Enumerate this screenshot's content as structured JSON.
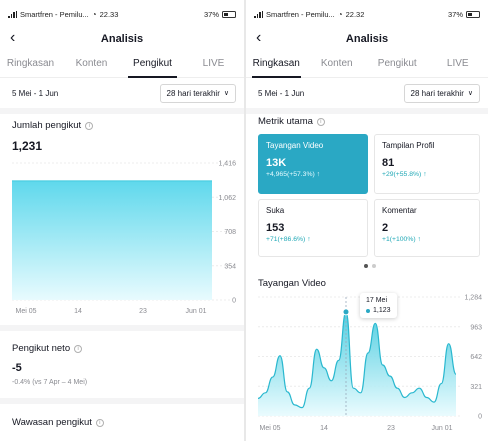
{
  "left": {
    "status": {
      "carrier": "Smartfren - Pemilu...",
      "time": "22.33",
      "battery": "37%"
    },
    "nav_title": "Analisis",
    "tabs": [
      "Ringkasan",
      "Konten",
      "Pengikut",
      "LIVE"
    ],
    "active_tab": "Pengikut",
    "date_range": "5 Mei - 1 Jun",
    "period_select": "28 hari terakhir",
    "followers": {
      "title": "Jumlah pengikut",
      "value": "1,231",
      "chart_data": {
        "type": "area",
        "x_labels": [
          "Mei 05",
          "14",
          "23",
          "Jun 01"
        ],
        "x": [
          "Mei 05",
          "Jun 01"
        ],
        "values": [
          1231,
          1231
        ],
        "y_ticks": [
          "1,416",
          "1,062",
          "708",
          "354",
          "0"
        ],
        "ylim": [
          0,
          1416
        ],
        "color": "#5fd8ec"
      }
    },
    "net": {
      "title": "Pengikut neto",
      "value": "-5",
      "change": "-0.4% (vs 7 Apr – 4 Mei)"
    },
    "insight": {
      "title": "Wawasan pengikut"
    }
  },
  "right": {
    "status": {
      "carrier": "Smartfren - Pemilu...",
      "time": "22.32",
      "battery": "37%"
    },
    "nav_title": "Analisis",
    "tabs": [
      "Ringkasan",
      "Konten",
      "Pengikut",
      "LIVE"
    ],
    "active_tab": "Ringkasan",
    "date_range": "5 Mei - 1 Jun",
    "period_select": "28 hari terakhir",
    "metrics_title": "Metrik utama",
    "metrics": [
      {
        "label": "Tayangan Video",
        "value": "13K",
        "change": "+4,965(+57.3%)",
        "selected": true
      },
      {
        "label": "Tampilan Profil",
        "value": "81",
        "change": "+29(+55.8%)",
        "selected": false
      },
      {
        "label": "Suka",
        "value": "153",
        "change": "+71(+86.6%)",
        "selected": false
      },
      {
        "label": "Komentar",
        "value": "2",
        "change": "+1(+100%)",
        "selected": false
      }
    ],
    "views_chart": {
      "title": "Tayangan Video",
      "tooltip": {
        "date": "17 Mei",
        "value": "1,123"
      },
      "chart_data": {
        "type": "area",
        "x_labels": [
          "Mei 05",
          "14",
          "23",
          "Jun 01"
        ],
        "y_ticks": [
          "1,284",
          "963",
          "642",
          "321",
          "0"
        ],
        "ylim": [
          0,
          1284
        ],
        "values": [
          190,
          250,
          420,
          650,
          260,
          120,
          90,
          300,
          720,
          520,
          380,
          600,
          1123,
          300,
          250,
          680,
          1000,
          550,
          430,
          300,
          200,
          250,
          300,
          200,
          150,
          350,
          780,
          450
        ],
        "highlight_index": 12,
        "color": "#3fc9de"
      }
    }
  }
}
